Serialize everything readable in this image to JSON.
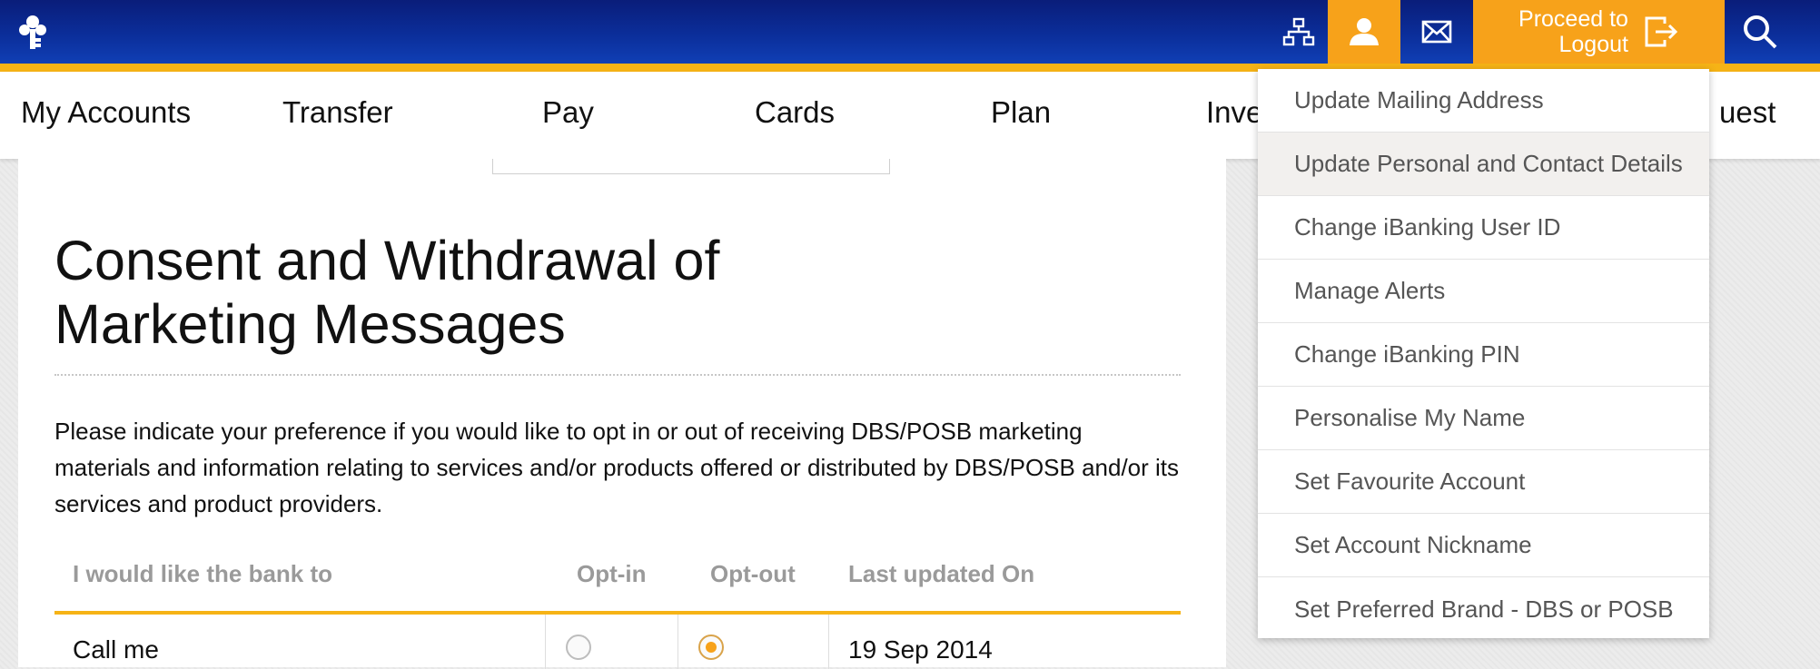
{
  "header": {
    "logout_label_line1": "Proceed to",
    "logout_label_line2": "Logout",
    "icons": [
      "dbs-logo-icon",
      "sitemap-icon",
      "profile-icon",
      "mail-icon",
      "logout-icon",
      "search-icon"
    ],
    "colors": {
      "bar": "#0b2e9a",
      "accent": "#f7a21a",
      "strip": "#f6b316"
    }
  },
  "nav": {
    "items": [
      "My Accounts",
      "Transfer",
      "Pay",
      "Cards",
      "Plan",
      "Inve",
      "uest"
    ]
  },
  "main": {
    "title": "Consent and Withdrawal of Marketing Messages",
    "intro": "Please indicate your preference if you would like to opt in or out of receiving DBS/POSB marketing materials and information relating to services and/or products offered or distributed by DBS/POSB and/or its services and product providers.",
    "table": {
      "headers": [
        "I would like the bank to",
        "Opt-in",
        "Opt-out",
        "Last updated On"
      ],
      "rows": [
        {
          "label": "Call me",
          "opt_in": false,
          "opt_out": true,
          "updated": "19 Sep 2014"
        }
      ]
    }
  },
  "dropdown": {
    "items": [
      "Update Mailing Address",
      "Update Personal and Contact Details",
      "Change iBanking User ID",
      "Manage Alerts",
      "Change iBanking PIN",
      "Personalise My Name",
      "Set Favourite Account",
      "Set Account Nickname",
      "Set Preferred Brand - DBS or POSB"
    ],
    "highlighted": "Update Personal and Contact Details"
  }
}
